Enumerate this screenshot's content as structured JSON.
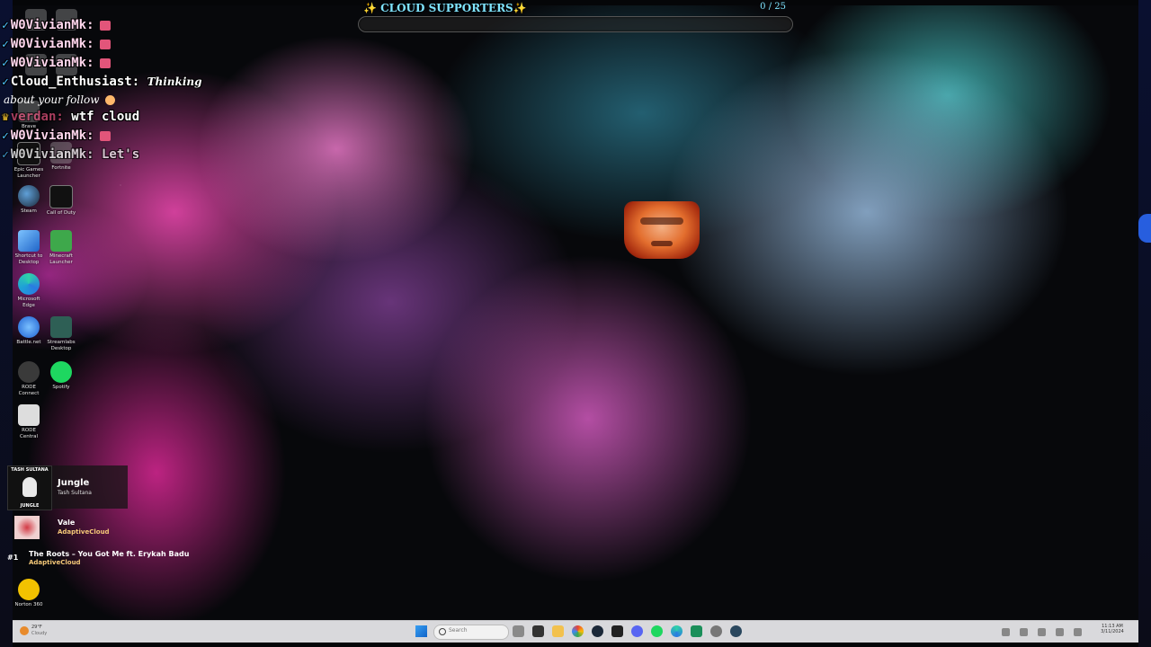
{
  "goal": {
    "title": "✨ CLOUD SUPPORTERS✨",
    "count": "0 / 25",
    "progress_fraction": 0.0,
    "color": "#7fe4ff"
  },
  "chat": {
    "lines": [
      {
        "user": "W0VivianMk:",
        "message": "",
        "emote": "heart-emote"
      },
      {
        "user": "W0VivianMk:",
        "message": "",
        "emote": "heart-emote"
      },
      {
        "user": "W0VivianMk:",
        "message": "",
        "emote": "heart-emote"
      },
      {
        "user": "Cloud_Enthusiast:",
        "message": "Thinking",
        "continuation": "about your follow"
      },
      {
        "user": "verdan:",
        "message": "wtf cloud"
      },
      {
        "user": "W0VivianMk:",
        "message": "",
        "emote": "heart-emote"
      },
      {
        "user": "W0VivianMk:",
        "message": "Let's"
      }
    ]
  },
  "desktop_icons": [
    {
      "label": "",
      "icon": "faint-app-icon"
    },
    {
      "label": "",
      "icon": "faint-app-icon"
    },
    {
      "label": "",
      "icon": "faint-app-icon"
    },
    {
      "label": "",
      "icon": "faint-app-icon"
    },
    {
      "label": "Brave Chrome",
      "icon": "browser-icon"
    },
    {
      "label": "Epic Games Launcher",
      "icon": "epic-games-icon"
    },
    {
      "label": "Fortnite",
      "icon": "fortnite-icon"
    },
    {
      "label": "Steam",
      "icon": "steam-icon"
    },
    {
      "label": "Call of Duty",
      "icon": "call-of-duty-icon"
    },
    {
      "label": "Shortcut to Desktop",
      "icon": "shortcut-icon"
    },
    {
      "label": "Minecraft Launcher",
      "icon": "minecraft-icon"
    },
    {
      "label": "Microsoft Edge",
      "icon": "edge-icon"
    },
    {
      "label": "Battle.net",
      "icon": "battlenet-icon"
    },
    {
      "label": "Streamlabs Desktop",
      "icon": "streamlabs-icon"
    },
    {
      "label": "RODE Connect",
      "icon": "rode-connect-icon"
    },
    {
      "label": "Spotify",
      "icon": "spotify-icon"
    },
    {
      "label": "RODE Central",
      "icon": "rode-central-icon"
    },
    {
      "label": "Norton 360",
      "icon": "norton-icon"
    }
  ],
  "now_playing": {
    "art_top": "TASH SULTANA",
    "art_bottom": "JUNGLE",
    "title": "Jungle",
    "artist": "Tash Sultana"
  },
  "current_song": {
    "title": "Vale",
    "requester": "AdaptiveCloud"
  },
  "queue": [
    {
      "rank": "#1",
      "title": "The Roots – You Got Me ft. Erykah Badu",
      "requester": "AdaptiveCloud"
    }
  ],
  "taskbar": {
    "weather_temp": "29°F",
    "weather_cond": "Cloudy",
    "search_placeholder": "Search",
    "clock_time": "11:13 AM",
    "clock_date": "3/11/2024",
    "apps": [
      "task-view-icon",
      "widgets-icon",
      "file-explorer-icon",
      "chrome-icon",
      "steam-taskbar-icon",
      "terminal-icon",
      "discord-icon",
      "spotify-taskbar-icon",
      "edge-taskbar-icon",
      "app-green-icon",
      "settings-icon",
      "steam-alt-icon"
    ]
  }
}
